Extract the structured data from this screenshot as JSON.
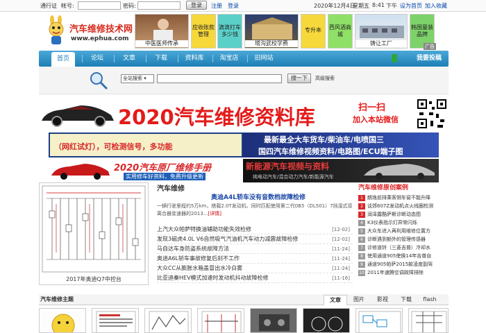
{
  "topbar": {
    "pass_label": "通行证",
    "account_label": "帐号:",
    "password_label": "密码:",
    "login_button": "登录",
    "register_link": "注册",
    "login_link": "登录",
    "date": "2020年12月4日",
    "weekday": "星期五",
    "time": "8:41",
    "ampm": "下午",
    "set_home": "设为首页",
    "favorite": "加入收藏"
  },
  "logo": {
    "title": "汽车维修技术网",
    "url": "www.ephua.com"
  },
  "header_ads": [
    {
      "label": "中医医师传承"
    },
    {
      "label": "应收账款管理"
    },
    {
      "label": "滴滴打车多少钱"
    },
    {
      "label": "塔沟武校学费"
    },
    {
      "label": "专升本"
    },
    {
      "label": "西风酒商城"
    },
    {
      "label": "铸让工厂"
    },
    {
      "label": "韩国童装品牌"
    }
  ],
  "ad_mark": "广告",
  "nav": {
    "items": [
      "首页",
      "论坛",
      "文章",
      "下载",
      "资料库",
      "淘宝店",
      "旧网站"
    ],
    "post": "我要投稿"
  },
  "search": {
    "scope": "全站搜索",
    "button": "搜一下",
    "advanced": "高级搜索"
  },
  "banners": {
    "b1_title": "2020汽车维修资料库",
    "b1_scan": "扫一扫",
    "b1_wechat": "加入本站微信",
    "b2_left": "（网红试灯），可检测信号，多功能",
    "b2_right_1": "最新最全大车货车/柴油车/电喷国三",
    "b2_right_2": "国四汽车维修视频资料/电路图/ECU端子图",
    "b3_left_1": "2020汽车原厂维修手册",
    "b3_left_2": "实用修车好资料，免费升级更新",
    "b3_right_1": "新能源汽车视频与资料",
    "b3_right_2": "纯电动汽车/混合动力汽车/新能源汽车"
  },
  "wiring_caption": "2017年奥迪Q7中控台",
  "news": {
    "section": "汽车维修",
    "headline": "奥迪A4L轿车没有音数档故障检修",
    "summary": "一辆行驶里程约5万km，搭载2.0T发动机、同时匹配使用第二代0B5（DL501）7挡湿式双离合器变速器的2013...",
    "more": "[详情]",
    "items": [
      {
        "title": "上汽大众帕萨特换油辅助功能失效检修",
        "date": "[12-02]"
      },
      {
        "title": "发现3磁虎4.0L V6自然吸气汽油机汽车动力减震故障检修",
        "date": "[12-02]"
      },
      {
        "title": "马自达车身防盗系统故障方法",
        "date": "[11-24]"
      },
      {
        "title": "奥迪A6L轿车事故修复后刹不工作",
        "date": "[11-24]"
      },
      {
        "title": "大众CC从膨胀水箱盖冒出水冷白雾",
        "date": "[11-24]"
      },
      {
        "title": "比亚迪秦HEV模式加速时发动机抖动故障检修",
        "date": "[11-16]"
      }
    ]
  },
  "cases": {
    "section": "汽车维修原创案例",
    "items": [
      {
        "n": "1",
        "title": "朗逸前排乘客侧车窗不能升降"
      },
      {
        "n": "2",
        "title": "谈郊607Z发动机点火线圈检测"
      },
      {
        "n": "3",
        "title": "润泽露酷萨斯诊断动态图"
      },
      {
        "n": "4",
        "title": "K3仪表指示灯异常闪烁"
      },
      {
        "n": "5",
        "title": "大众车进入再利用维修位置方"
      },
      {
        "n": "6",
        "title": "诊断遇到额外的管理传感器"
      },
      {
        "n": "7",
        "title": "诊修道铃（三菱吉普）冷却水"
      },
      {
        "n": "8",
        "title": "使用通道905使换14年吉普自"
      },
      {
        "n": "9",
        "title": "通道905帕萨2015款凌度副驾"
      },
      {
        "n": "10",
        "title": "2011年速腾空调故障排除"
      }
    ]
  },
  "topics": {
    "title": "汽车维修主题",
    "tabs": [
      "文章",
      "图片",
      "影视",
      "下载",
      "flash"
    ]
  },
  "colors": {
    "brand_red": "#d62a1c",
    "nav_blue": "#1e7fb5",
    "link_blue": "#1e4aa8"
  }
}
